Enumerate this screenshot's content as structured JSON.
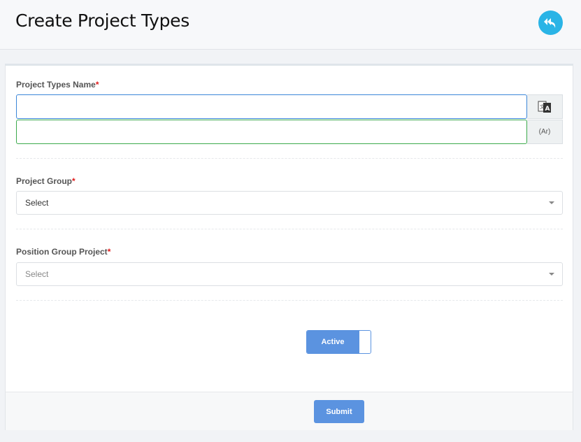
{
  "header": {
    "title": "Create Project Types",
    "back_icon": "reply-arrow-icon",
    "back_color": "#2ab4e6"
  },
  "form": {
    "project_types_name": {
      "label": "Project Types Name",
      "required_mark": "*",
      "value_en": "",
      "value_ar": "",
      "translate_icon": "translate-icon",
      "ar_addon": "(Ar)"
    },
    "project_group": {
      "label": "Project Group",
      "required_mark": "*",
      "selected": "Select"
    },
    "position_group_project": {
      "label": "Position Group Project",
      "required_mark": "*",
      "selected": "Select"
    },
    "status_toggle": {
      "label": "Active",
      "on": true
    },
    "submit_label": "Submit"
  },
  "colors": {
    "accent": "#5b93e0",
    "required": "#e01b1b",
    "en_input_border": "#3b86d8",
    "ar_input_border": "#3caa4c"
  }
}
